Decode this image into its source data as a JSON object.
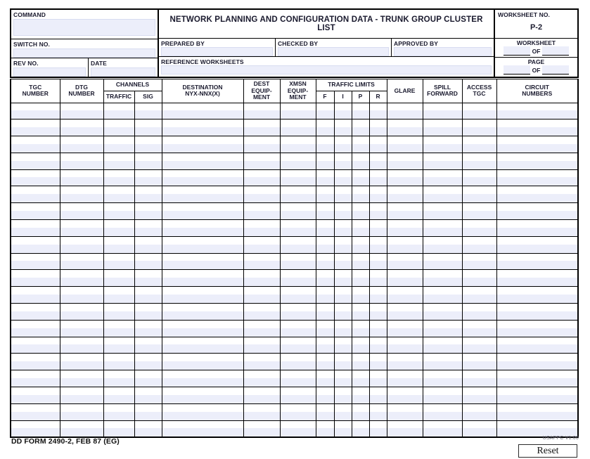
{
  "form": {
    "title": "NETWORK PLANNING AND CONFIGURATION DATA - TRUNK GROUP CLUSTER LIST",
    "form_id": "DD FORM 2490-2, FEB 87 (EG)",
    "vendor_mark": "USAPPC V1.00",
    "reset_label": "Reset"
  },
  "header": {
    "command_label": "COMMAND",
    "command_value": "",
    "switch_no_label": "SWITCH NO.",
    "switch_no_value": "",
    "rev_no_label": "REV NO.",
    "rev_no_value": "",
    "date_label": "DATE",
    "date_value": "",
    "prepared_by_label": "PREPARED BY",
    "prepared_by_value": "",
    "checked_by_label": "CHECKED BY",
    "checked_by_value": "",
    "approved_by_label": "APPROVED BY",
    "approved_by_value": "",
    "reference_worksheets_label": "REFERENCE WORKSHEETS",
    "reference_worksheets_value": "",
    "worksheet_no_label": "WORKSHEET NO.",
    "worksheet_no_value": "P-2",
    "worksheet_label": "WORKSHEET",
    "worksheet_of_label": "OF",
    "worksheet_num_value": "",
    "worksheet_total_value": "",
    "page_label": "PAGE",
    "page_of_label": "OF",
    "page_num_value": "",
    "page_total_value": ""
  },
  "table": {
    "headers": {
      "tgc_number": "TGC\nNUMBER",
      "tgc_number_l1": "TGC",
      "tgc_number_l2": "NUMBER",
      "dtg_number_l1": "DTG",
      "dtg_number_l2": "NUMBER",
      "channels": "CHANNELS",
      "channels_traffic": "TRAFFIC",
      "channels_sig": "SIG",
      "destination_l1": "DESTINATION",
      "destination_l2": "NYX-NNX(X)",
      "dest_equip_l1": "DEST",
      "dest_equip_l2": "EQUIP-",
      "dest_equip_l3": "MENT",
      "xmsn_equip_l1": "XMSN",
      "xmsn_equip_l2": "EQUIP-",
      "xmsn_equip_l3": "MENT",
      "traffic_limits": "TRAFFIC LIMITS",
      "traffic_f": "F",
      "traffic_i": "I",
      "traffic_p": "P",
      "traffic_r": "R",
      "glare": "GLARE",
      "spill_forward_l1": "SPILL",
      "spill_forward_l2": "FORWARD",
      "access_tgc_l1": "ACCESS",
      "access_tgc_l2": "TGC",
      "circuit_numbers_l1": "CIRCUIT",
      "circuit_numbers_l2": "NUMBERS"
    },
    "row_count": 20,
    "column_count": 15,
    "rows": [
      [
        "",
        "",
        "",
        "",
        "",
        "",
        "",
        "",
        "",
        "",
        "",
        "",
        "",
        "",
        ""
      ],
      [
        "",
        "",
        "",
        "",
        "",
        "",
        "",
        "",
        "",
        "",
        "",
        "",
        "",
        "",
        ""
      ],
      [
        "",
        "",
        "",
        "",
        "",
        "",
        "",
        "",
        "",
        "",
        "",
        "",
        "",
        "",
        ""
      ],
      [
        "",
        "",
        "",
        "",
        "",
        "",
        "",
        "",
        "",
        "",
        "",
        "",
        "",
        "",
        ""
      ],
      [
        "",
        "",
        "",
        "",
        "",
        "",
        "",
        "",
        "",
        "",
        "",
        "",
        "",
        "",
        ""
      ],
      [
        "",
        "",
        "",
        "",
        "",
        "",
        "",
        "",
        "",
        "",
        "",
        "",
        "",
        "",
        ""
      ],
      [
        "",
        "",
        "",
        "",
        "",
        "",
        "",
        "",
        "",
        "",
        "",
        "",
        "",
        "",
        ""
      ],
      [
        "",
        "",
        "",
        "",
        "",
        "",
        "",
        "",
        "",
        "",
        "",
        "",
        "",
        "",
        ""
      ],
      [
        "",
        "",
        "",
        "",
        "",
        "",
        "",
        "",
        "",
        "",
        "",
        "",
        "",
        "",
        ""
      ],
      [
        "",
        "",
        "",
        "",
        "",
        "",
        "",
        "",
        "",
        "",
        "",
        "",
        "",
        "",
        ""
      ],
      [
        "",
        "",
        "",
        "",
        "",
        "",
        "",
        "",
        "",
        "",
        "",
        "",
        "",
        "",
        ""
      ],
      [
        "",
        "",
        "",
        "",
        "",
        "",
        "",
        "",
        "",
        "",
        "",
        "",
        "",
        "",
        ""
      ],
      [
        "",
        "",
        "",
        "",
        "",
        "",
        "",
        "",
        "",
        "",
        "",
        "",
        "",
        "",
        ""
      ],
      [
        "",
        "",
        "",
        "",
        "",
        "",
        "",
        "",
        "",
        "",
        "",
        "",
        "",
        "",
        ""
      ],
      [
        "",
        "",
        "",
        "",
        "",
        "",
        "",
        "",
        "",
        "",
        "",
        "",
        "",
        "",
        ""
      ],
      [
        "",
        "",
        "",
        "",
        "",
        "",
        "",
        "",
        "",
        "",
        "",
        "",
        "",
        "",
        ""
      ],
      [
        "",
        "",
        "",
        "",
        "",
        "",
        "",
        "",
        "",
        "",
        "",
        "",
        "",
        "",
        ""
      ],
      [
        "",
        "",
        "",
        "",
        "",
        "",
        "",
        "",
        "",
        "",
        "",
        "",
        "",
        "",
        ""
      ],
      [
        "",
        "",
        "",
        "",
        "",
        "",
        "",
        "",
        "",
        "",
        "",
        "",
        "",
        "",
        ""
      ],
      [
        "",
        "",
        "",
        "",
        "",
        "",
        "",
        "",
        "",
        "",
        "",
        "",
        "",
        "",
        ""
      ]
    ]
  },
  "colors": {
    "field_fill": "#eceefa",
    "border": "#000000",
    "text": "#1a1a2e",
    "page_bg": "#ffffff"
  }
}
